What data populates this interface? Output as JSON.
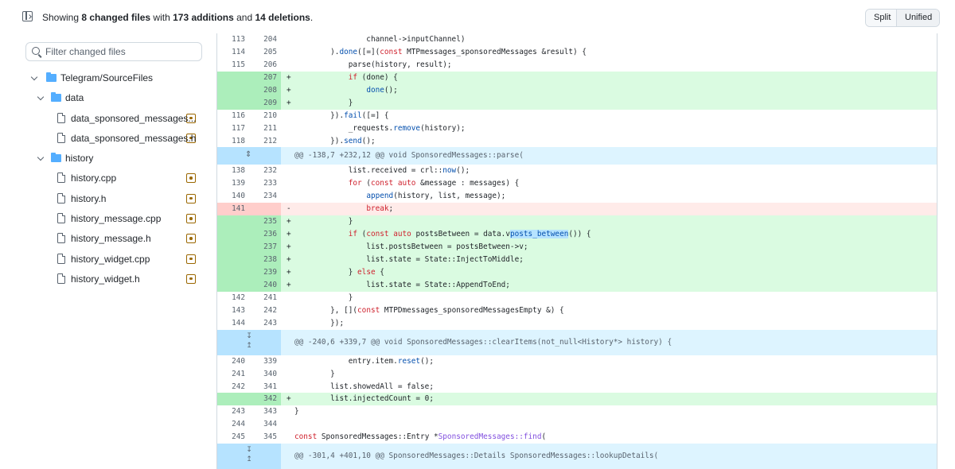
{
  "header": {
    "summary_prefix": "Showing ",
    "changed_files": "8 changed files",
    "summary_mid": " with ",
    "additions": "173 additions",
    "summary_and": " and ",
    "deletions": "14 deletions",
    "summary_end": ".",
    "split_label": "Split",
    "unified_label": "Unified",
    "selected_view": "Unified"
  },
  "sidebar": {
    "filter_placeholder": "Filter changed files",
    "tree": [
      {
        "type": "folder",
        "label": "Telegram/SourceFiles",
        "depth": 0
      },
      {
        "type": "folder",
        "label": "data",
        "depth": 1
      },
      {
        "type": "file",
        "label": "data_sponsored_messages...",
        "depth": 2
      },
      {
        "type": "file",
        "label": "data_sponsored_messages.h",
        "depth": 2
      },
      {
        "type": "folder",
        "label": "history",
        "depth": 1
      },
      {
        "type": "file",
        "label": "history.cpp",
        "depth": 2
      },
      {
        "type": "file",
        "label": "history.h",
        "depth": 2
      },
      {
        "type": "file",
        "label": "history_message.cpp",
        "depth": 2
      },
      {
        "type": "file",
        "label": "history_message.h",
        "depth": 2
      },
      {
        "type": "file",
        "label": "history_widget.cpp",
        "depth": 2
      },
      {
        "type": "file",
        "label": "history_widget.h",
        "depth": 2
      }
    ]
  },
  "diff": {
    "lines": [
      {
        "t": "ctx",
        "o": "113",
        "n": "204",
        "c": "                channel->inputChannel)"
      },
      {
        "t": "ctx",
        "o": "114",
        "n": "205",
        "c": "        ).done([=](const MTPmessages_sponsoredMessages &result) {"
      },
      {
        "t": "ctx",
        "o": "115",
        "n": "206",
        "c": "            parse(history, result);"
      },
      {
        "t": "add",
        "o": "",
        "n": "207",
        "c": "            if (done) {"
      },
      {
        "t": "add",
        "o": "",
        "n": "208",
        "c": "                done();"
      },
      {
        "t": "add",
        "o": "",
        "n": "209",
        "c": "            }"
      },
      {
        "t": "ctx",
        "o": "116",
        "n": "210",
        "c": "        }).fail([=] {"
      },
      {
        "t": "ctx",
        "o": "117",
        "n": "211",
        "c": "            _requests.remove(history);"
      },
      {
        "t": "ctx",
        "o": "118",
        "n": "212",
        "c": "        }).send();"
      },
      {
        "t": "hunk",
        "o": "",
        "n": "",
        "c": "@@ -138,7 +232,12 @@ void SponsoredMessages::parse("
      },
      {
        "t": "ctx",
        "o": "138",
        "n": "232",
        "c": "            list.received = crl::now();"
      },
      {
        "t": "ctx",
        "o": "139",
        "n": "233",
        "c": "            for (const auto &message : messages) {"
      },
      {
        "t": "ctx",
        "o": "140",
        "n": "234",
        "c": "                append(history, list, message);"
      },
      {
        "t": "del",
        "o": "141",
        "n": "",
        "c": "                break;"
      },
      {
        "t": "add",
        "o": "",
        "n": "235",
        "c": "            }"
      },
      {
        "t": "add",
        "o": "",
        "n": "236",
        "c": "            if (const auto postsBetween = data.vposts_between()) {"
      },
      {
        "t": "add",
        "o": "",
        "n": "237",
        "c": "                list.postsBetween = postsBetween->v;"
      },
      {
        "t": "add",
        "o": "",
        "n": "238",
        "c": "                list.state = State::InjectToMiddle;"
      },
      {
        "t": "add",
        "o": "",
        "n": "239",
        "c": "            } else {"
      },
      {
        "t": "add",
        "o": "",
        "n": "240",
        "c": "                list.state = State::AppendToEnd;"
      },
      {
        "t": "ctx",
        "o": "142",
        "n": "241",
        "c": "            }"
      },
      {
        "t": "ctx",
        "o": "143",
        "n": "242",
        "c": "        }, [](const MTPDmessages_sponsoredMessagesEmpty &) {"
      },
      {
        "t": "ctx",
        "o": "144",
        "n": "243",
        "c": "        });"
      },
      {
        "t": "hunk2",
        "o": "",
        "n": "",
        "c": "@@ -240,6 +339,7 @@ void SponsoredMessages::clearItems(not_null<History*> history) {"
      },
      {
        "t": "ctx",
        "o": "240",
        "n": "339",
        "c": "            entry.item.reset();"
      },
      {
        "t": "ctx",
        "o": "241",
        "n": "340",
        "c": "        }"
      },
      {
        "t": "ctx",
        "o": "242",
        "n": "341",
        "c": "        list.showedAll = false;"
      },
      {
        "t": "add",
        "o": "",
        "n": "342",
        "c": "        list.injectedCount = 0;"
      },
      {
        "t": "ctx",
        "o": "243",
        "n": "343",
        "c": "}"
      },
      {
        "t": "ctx",
        "o": "244",
        "n": "344",
        "c": ""
      },
      {
        "t": "ctx",
        "o": "245",
        "n": "345",
        "c": "const SponsoredMessages::Entry *SponsoredMessages::find("
      },
      {
        "t": "hunk2",
        "o": "",
        "n": "",
        "c": "@@ -301,4 +401,10 @@ SponsoredMessages::Details SponsoredMessages::lookupDetails("
      }
    ]
  },
  "colors": {
    "addition_bg": "#dafbe1",
    "deletion_bg": "#ffebe9",
    "hunk_bg": "#ddf4ff",
    "modified_badge": "#9a6700",
    "folder": "#54aeff"
  }
}
